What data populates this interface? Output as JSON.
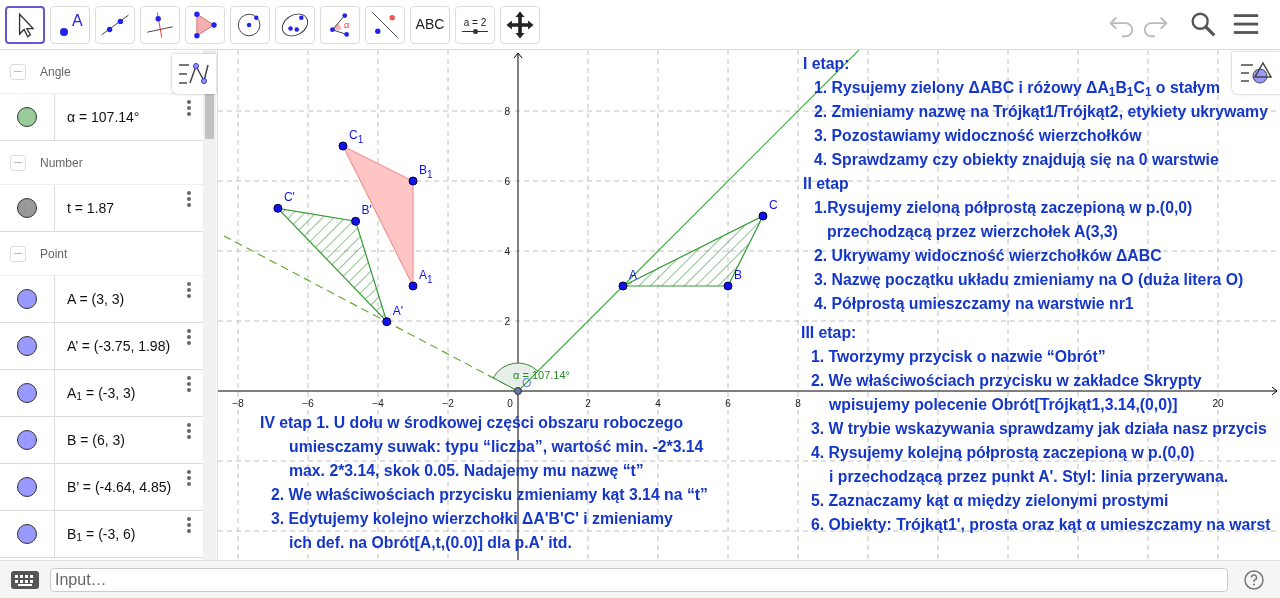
{
  "toolbar": {
    "tools": [
      {
        "kind": "move",
        "selected": true
      },
      {
        "kind": "point",
        "label": "A",
        "selected": false
      },
      {
        "kind": "line",
        "selected": false
      },
      {
        "kind": "perpendicular",
        "selected": false
      },
      {
        "kind": "polygon",
        "selected": false
      },
      {
        "kind": "circle",
        "selected": false
      },
      {
        "kind": "conic",
        "selected": false
      },
      {
        "kind": "angle",
        "label": "α",
        "selected": false
      },
      {
        "kind": "reflect",
        "selected": false
      },
      {
        "kind": "text",
        "label": "ABC",
        "selected": false
      },
      {
        "kind": "slider",
        "label": "a = 2",
        "selected": false
      },
      {
        "kind": "pan",
        "selected": false
      }
    ],
    "actions": [
      {
        "kind": "undo",
        "disabled": true
      },
      {
        "kind": "redo",
        "disabled": true
      },
      {
        "kind": "search",
        "disabled": false
      },
      {
        "kind": "menu",
        "disabled": false
      }
    ]
  },
  "algebra": {
    "groups": [
      {
        "label": "Angle",
        "expanded": true,
        "items": [
          {
            "value": "α = 107.14°",
            "color": "#99cc99"
          }
        ]
      },
      {
        "label": "Number",
        "expanded": true,
        "items": [
          {
            "value": "t = 1.87",
            "color": "#999999"
          }
        ]
      },
      {
        "label": "Point",
        "expanded": true,
        "items": [
          {
            "value": "A = (3, 3)",
            "color": "#9999ff"
          },
          {
            "value": "A’ = (-3.75, 1.98)",
            "color": "#9999ff"
          },
          {
            "value": "A$_{1}$ = (-3, 3)",
            "color": "#9999ff"
          },
          {
            "value": "B = (6, 3)",
            "color": "#9999ff"
          },
          {
            "value": "B’ = (-4.64, 4.85)",
            "color": "#9999ff"
          },
          {
            "value": "B$_{1}$ = (-3, 6)",
            "color": "#9999ff"
          }
        ]
      }
    ]
  },
  "graphics": {
    "x_ticks": [
      "−8",
      "−6",
      "−4",
      "−2",
      "0",
      "2",
      "4",
      "6",
      "8",
      "20"
    ],
    "y_ticks": [
      "8",
      "6",
      "4",
      "2"
    ],
    "points": [
      {
        "label": "A"
      },
      {
        "label": "B"
      },
      {
        "label": "C"
      },
      {
        "label": "A",
        "sub": "1"
      },
      {
        "label": "B",
        "sub": "1"
      },
      {
        "label": "C",
        "sub": "1"
      },
      {
        "label": "A'"
      },
      {
        "label": "B'"
      },
      {
        "label": "C'"
      }
    ],
    "angle_label": "α = 107.14°",
    "origin_label": "O",
    "text_blocks": [
      {
        "lines": [
          {
            "kind": "heading",
            "text": "IV etap 1. U dołu w środkowej części obszaru roboczego"
          },
          {
            "kind": "cont",
            "text": "umiesczamy suwak: typu “liczba”, wartość min. -2*3.14"
          },
          {
            "kind": "cont",
            "text": "max. 2*3.14, skok 0.05. Nadajemy mu nazwę “t”"
          },
          {
            "kind": "step",
            "text": "2. We właściwościach przycisku zmieniamy kąt 3.14 na “t”"
          },
          {
            "kind": "step",
            "text": "3. Edytujemy kolejno wierzchołki ΔA'B'C' i zmieniamy"
          },
          {
            "kind": "cont",
            "text": "ich def. na Obrót[A,t,(0.0)] dla p.A' itd."
          }
        ]
      },
      {
        "lines": [
          {
            "kind": "heading",
            "text": "I etap:"
          },
          {
            "kind": "step",
            "text": "1. Rysujemy zielony ΔABC i różowy ΔA$_{1}$B$_{1}$C$_{1}$ o stałym"
          },
          {
            "kind": "step",
            "text": "2. Zmieniamy nazwę na Trójkąt1/Trójkąt2, etykiety ukrywamy"
          },
          {
            "kind": "step",
            "text": "3. Pozostawiamy widoczność wierzchołków"
          },
          {
            "kind": "step",
            "text": "4. Sprawdzamy czy obiekty znajdują się na 0 warstwie"
          },
          {
            "kind": "heading",
            "text": "II etap"
          },
          {
            "kind": "step",
            "text": "1.Rysujemy zieloną półprostą zaczepioną w p.(0,0)"
          },
          {
            "kind": "cont",
            "text": "przechodzącą przez wierzchołek A(3,3)"
          },
          {
            "kind": "step",
            "text": "2. Ukrywamy widoczność wierzchołków ΔABC"
          },
          {
            "kind": "step",
            "text": "3. Nazwę początku układu zmieniamy na O (duża litera O)"
          },
          {
            "kind": "step",
            "text": "4. Półprostą umieszczamy na warstwie nr1"
          }
        ]
      },
      {
        "lines": [
          {
            "kind": "heading",
            "text": "III etap:"
          },
          {
            "kind": "step",
            "text": "1. Tworzymy przycisk o nazwie “Obrót”"
          },
          {
            "kind": "step",
            "text": "2. We właściwościach przycisku w zakładce Skrypty"
          },
          {
            "kind": "cont",
            "text": "wpisujemy polecenie Obrót[Trójkąt1,3.14,(0,0)]"
          },
          {
            "kind": "step",
            "text": "3. W trybie wskazywania sprawdzamy jak działa nasz przycis"
          },
          {
            "kind": "step",
            "text": "4. Rysujemy kolejną półprostą zaczepioną w p.(0,0)"
          },
          {
            "kind": "cont",
            "text": "i przechodzącą przez punkt A'. Styl: linia przerywana."
          },
          {
            "kind": "step",
            "text": "5. Zaznaczamy kąt α między zielonymi prostymi"
          },
          {
            "kind": "step",
            "text": "6. Obiekty: Trójkąt1', prosta oraz kąt α umieszczamy na warst"
          }
        ]
      }
    ]
  },
  "input_bar": {
    "placeholder": "Input…"
  }
}
